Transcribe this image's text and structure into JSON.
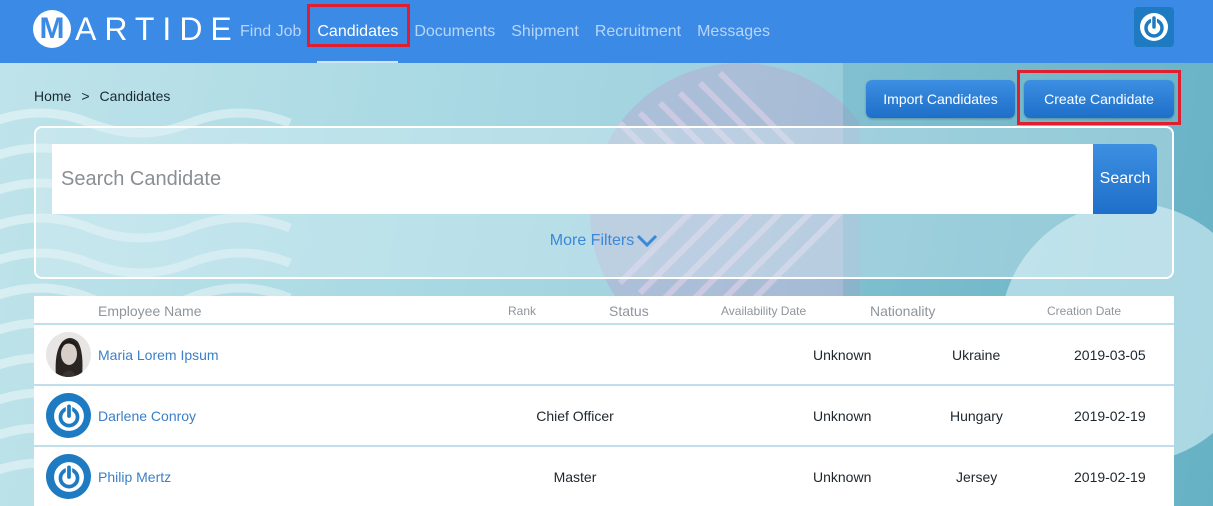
{
  "header": {
    "logo_letter": "M",
    "logo_text": "ARTIDE",
    "nav": [
      {
        "label": "Find Job",
        "active": false
      },
      {
        "label": "Candidates",
        "active": true
      },
      {
        "label": "Documents",
        "active": false
      },
      {
        "label": "Shipment",
        "active": false
      },
      {
        "label": "Recruitment",
        "active": false
      },
      {
        "label": "Messages",
        "active": false
      }
    ],
    "power_icon": "power-icon"
  },
  "breadcrumb": {
    "home": "Home",
    "separator": ">",
    "current": "Candidates"
  },
  "actions": {
    "import_label": "Import Candidates",
    "create_label": "Create Candidate"
  },
  "search": {
    "placeholder": "Search Candidate",
    "button_label": "Search",
    "more_filters_label": "More Filters"
  },
  "table": {
    "columns": [
      "Employee Name",
      "Rank",
      "Status",
      "Availability Date",
      "Nationality",
      "Creation Date"
    ],
    "rows": [
      {
        "name": "Maria Lorem Ipsum",
        "rank": "",
        "availability": "Unknown",
        "nationality": "Ukraine",
        "created": "2019-03-05",
        "avatar": "photo"
      },
      {
        "name": "Darlene Conroy",
        "rank": "Chief Officer",
        "availability": "Unknown",
        "nationality": "Hungary",
        "created": "2019-02-19",
        "avatar": "power-icon"
      },
      {
        "name": "Philip Mertz",
        "rank": "Master",
        "availability": "Unknown",
        "nationality": "Jersey",
        "created": "2019-02-19",
        "avatar": "power-icon"
      }
    ]
  },
  "colors": {
    "brand": "#3a8ae6",
    "highlight": "#e01e2f",
    "link": "#3b7fc7"
  }
}
